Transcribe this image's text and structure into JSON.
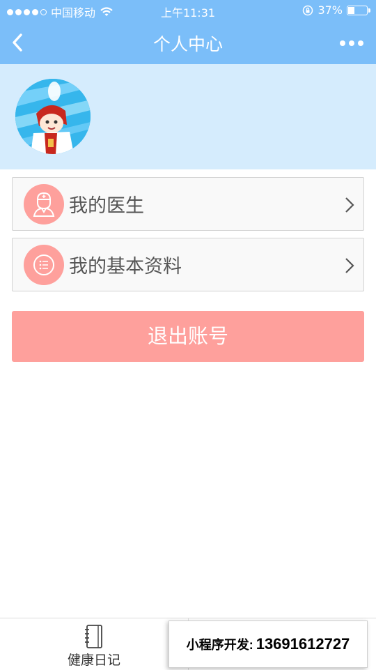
{
  "status_bar": {
    "carrier": "中国移动",
    "time": "上午11:31",
    "battery_percent": "37%",
    "battery_level": 0.37,
    "icons": [
      "signal-dots-icon",
      "wifi-icon",
      "rotation-lock-icon",
      "battery-icon"
    ]
  },
  "navbar": {
    "title": "个人中心",
    "back_icon": "chevron-left-icon",
    "more_icon": "more-dots-icon"
  },
  "colors": {
    "accent": "#7bbef9",
    "profile_bg": "#d5ecfd",
    "coral": "#fea09c"
  },
  "menu": {
    "items": [
      {
        "label": "我的医生",
        "icon": "doctor-icon"
      },
      {
        "label": "我的基本资料",
        "icon": "list-icon"
      }
    ]
  },
  "logout_label": "退出账号",
  "tabbar": {
    "tabs": [
      {
        "label": "健康日记",
        "icon": "notebook-icon"
      }
    ]
  },
  "promo": {
    "key": "小程序开发:",
    "value": "13691612727"
  }
}
